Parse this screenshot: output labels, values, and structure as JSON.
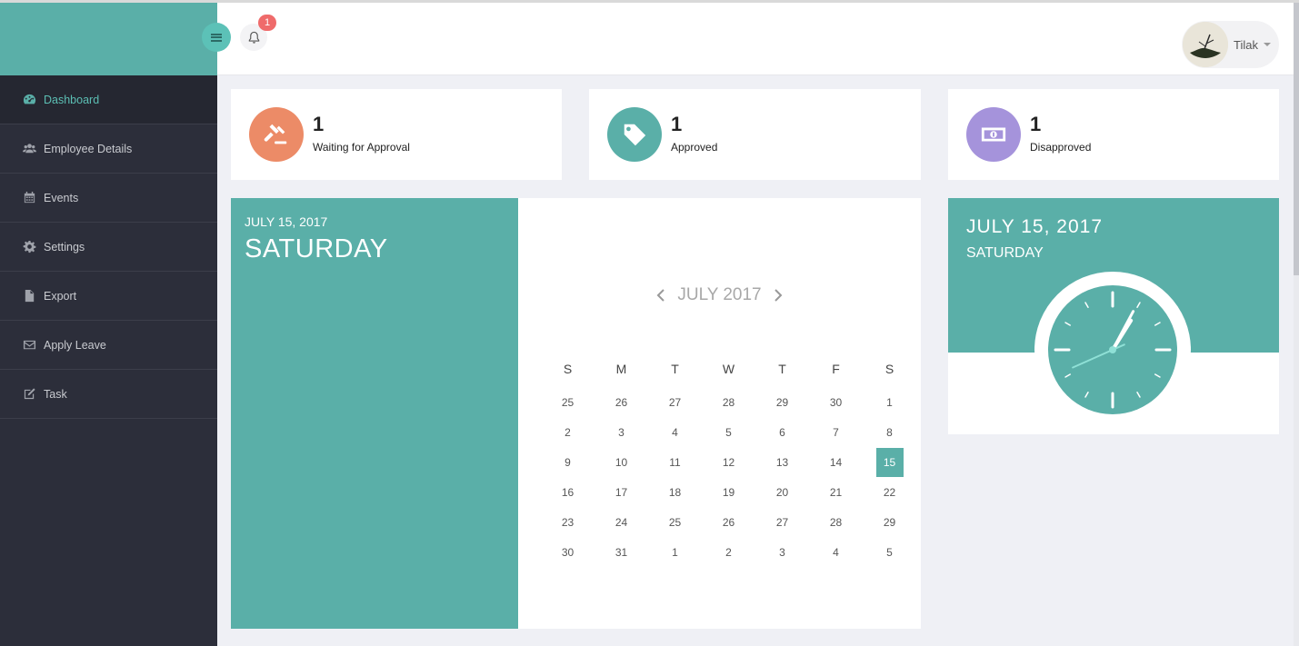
{
  "header": {
    "notification_count": "1",
    "user_name": "Tilak"
  },
  "sidebar": {
    "items": [
      {
        "label": "Dashboard",
        "icon": "dashboard-icon"
      },
      {
        "label": "Employee Details",
        "icon": "users-icon"
      },
      {
        "label": "Events",
        "icon": "calendar-icon"
      },
      {
        "label": "Settings",
        "icon": "gear-icon"
      },
      {
        "label": "Export",
        "icon": "file-icon"
      },
      {
        "label": "Apply Leave",
        "icon": "envelope-icon"
      },
      {
        "label": "Task",
        "icon": "edit-icon"
      }
    ]
  },
  "stats": [
    {
      "count": "1",
      "label": "Waiting for Approval",
      "icon": "gavel-icon",
      "color": "#ec8b67"
    },
    {
      "count": "1",
      "label": "Approved",
      "icon": "tag-icon",
      "color": "#5aafa8"
    },
    {
      "count": "1",
      "label": "Disapproved",
      "icon": "money-icon",
      "color": "#a593db"
    }
  ],
  "calendar": {
    "date": "JULY 15, 2017",
    "day": "SATURDAY",
    "month_label": "JULY 2017",
    "weekdays": [
      "S",
      "M",
      "T",
      "W",
      "T",
      "F",
      "S"
    ],
    "weeks": [
      [
        "25",
        "26",
        "27",
        "28",
        "29",
        "30",
        "1"
      ],
      [
        "2",
        "3",
        "4",
        "5",
        "6",
        "7",
        "8"
      ],
      [
        "9",
        "10",
        "11",
        "12",
        "13",
        "14",
        "15"
      ],
      [
        "16",
        "17",
        "18",
        "19",
        "20",
        "21",
        "22"
      ],
      [
        "23",
        "24",
        "25",
        "26",
        "27",
        "28",
        "29"
      ],
      [
        "30",
        "31",
        "1",
        "2",
        "3",
        "4",
        "5"
      ]
    ],
    "selected": "15"
  },
  "clock": {
    "date": "JULY 15, 2017",
    "day": "SATURDAY",
    "time": "13:04:41"
  },
  "colors": {
    "accent": "#5aafa8",
    "sidebar_bg": "#2c2e3a"
  }
}
